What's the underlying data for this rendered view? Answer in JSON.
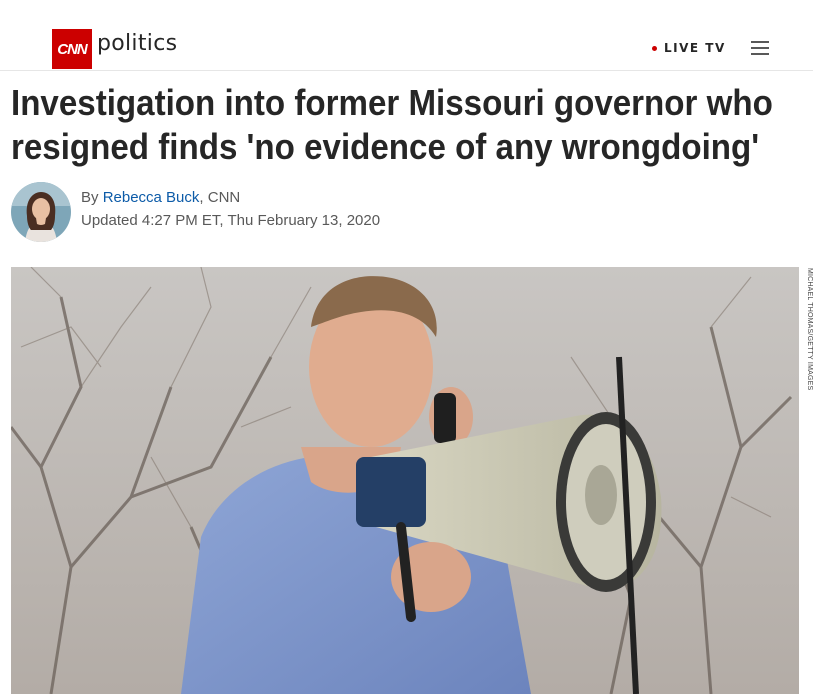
{
  "header": {
    "logo_text": "CNN",
    "section_name": "politics",
    "live_label": "LIVE TV",
    "brand_color": "#cc0000"
  },
  "article": {
    "headline": "Investigation into former Missouri governor who resigned finds 'no evidence of any wrongdoing'",
    "byline_prefix": "By ",
    "author": "Rebecca Buck",
    "byline_suffix": ", CNN",
    "updated": "Updated 4:27 PM ET, Thu February 13, 2020",
    "image_credit": "MICHAEL THOMAS/GETTY IMAGES"
  },
  "icons": {
    "menu": "hamburger-menu-icon",
    "live": "live-dot-icon"
  }
}
